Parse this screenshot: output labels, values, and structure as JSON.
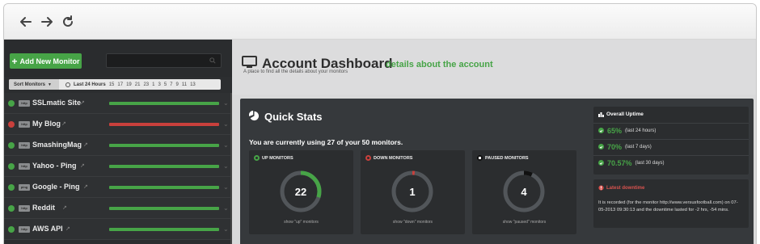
{
  "browser": {
    "back_icon": "arrow-left-icon",
    "forward_icon": "arrow-right-icon",
    "refresh_icon": "refresh-icon"
  },
  "sidebar": {
    "add_button_label": "Add New Monitor",
    "search_placeholder": "",
    "sort_label": "Sort Monitors",
    "period_label": "Last 24 Hours",
    "hour_ticks": [
      "15",
      "17",
      "19",
      "21",
      "23",
      "1",
      "3",
      "5",
      "7",
      "9",
      "11",
      "13"
    ],
    "monitors": [
      {
        "name": "SSLmatic Site",
        "protocol": "http",
        "status": "up",
        "bar_color": "#47a447"
      },
      {
        "name": "My Blog",
        "protocol": "http",
        "status": "down",
        "bar_color": "#c9403c"
      },
      {
        "name": "SmashingMag",
        "protocol": "http",
        "status": "up",
        "bar_color": "#47a447"
      },
      {
        "name": "Yahoo - Ping",
        "protocol": "http",
        "status": "up",
        "bar_color": "#47a447"
      },
      {
        "name": "Google - Ping",
        "protocol": "ping",
        "status": "up",
        "bar_color": "#47a447"
      },
      {
        "name": "Reddit",
        "protocol": "http",
        "status": "up",
        "bar_color": "#47a447"
      },
      {
        "name": "AWS API",
        "protocol": "http",
        "status": "up",
        "bar_color": "#47a447"
      }
    ]
  },
  "header": {
    "title": "Account Dashboard",
    "subtitle": "details about the account",
    "description": "A place to find all the details about your monitors"
  },
  "quick_stats": {
    "title": "Quick Stats",
    "usage_text": "You are currently using 27 of your 50 monitors.",
    "boxes": [
      {
        "label": "UP MONITORS",
        "count": "22",
        "link": "show \"up\" monitors",
        "color": "#47a447",
        "fraction": 0.3
      },
      {
        "label": "DOWN MONITORS",
        "count": "1",
        "link": "show \"down\" monitors",
        "color": "#c9403c",
        "fraction": 0.02
      },
      {
        "label": "PAUSED MONITORS",
        "count": "4",
        "link": "show \"paused\" monitors",
        "color": "#111111",
        "fraction": 0.07
      }
    ]
  },
  "overall_uptime": {
    "title": "Overall Uptime",
    "rows": [
      {
        "pct": "65%",
        "period": "(last 24 hours)"
      },
      {
        "pct": "70%",
        "period": "(last 7 days)"
      },
      {
        "pct": "70.57%",
        "period": "(last 30 days)"
      }
    ]
  },
  "latest_downtime": {
    "title": "Latest downtime",
    "text": "It is recorded (for the monitor http://www.versusfootball.com) on 07-05-2013 09:30:13 and the downtime lasted for -2 hrs, -54 mins."
  },
  "colors": {
    "accent": "#47a447",
    "danger": "#c9403c",
    "panel": "#36393c",
    "sidebar": "#2c2e30"
  }
}
